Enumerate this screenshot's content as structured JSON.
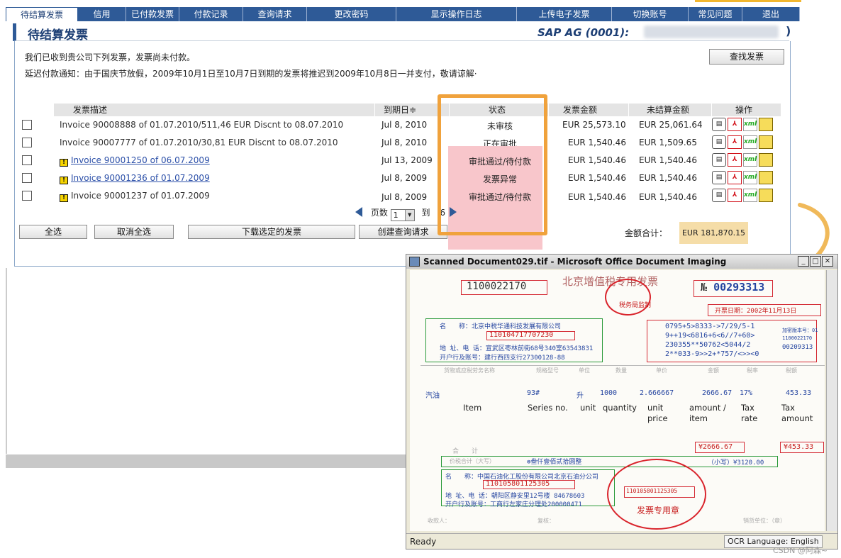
{
  "nav": {
    "tabs": [
      "待结算发票",
      "信用",
      "已付款发票",
      "付款记录",
      "查询请求",
      "更改密码",
      "显示操作日志",
      "上传电子发票",
      "切换账号",
      "常见问题",
      "退出"
    ]
  },
  "header": {
    "title": "待结算发票",
    "company": "SAP AG (0001):"
  },
  "messages": {
    "line1": "我们已收到贵公司下列发票，发票尚未付款。",
    "line2": "延迟付款通知：由于国庆节放假，2009年10月1日至10月7日到期的发票将推迟到2009年10月8日一并支付，敬请谅解·"
  },
  "buttons": {
    "find_invoice": "查找发票",
    "select_all": "全选",
    "deselect_all": "取消全选",
    "download_selected": "下载选定的发票",
    "create_query": "创建查询请求"
  },
  "table": {
    "headers": {
      "desc": "发票描述",
      "due": "到期日≑",
      "status": "状态",
      "amount": "发票金额",
      "open": "未结算金额",
      "ops": "操作"
    },
    "rows": [
      {
        "desc": "Invoice 90008888 of 01.07.2010/511,46 EUR Discnt to 08.07.2010",
        "due": "Jul 8, 2010",
        "status": "未审核",
        "amount": "EUR 25,573.10",
        "open": "EUR 25,061.64"
      },
      {
        "desc": "Invoice 90007777 of 01.07.2010/30,81 EUR Discnt to 08.07.2010",
        "due": "Jul 8, 2010",
        "status": "正在审批",
        "amount": "EUR 1,540.46",
        "open": "EUR 1,509.65"
      },
      {
        "desc": "Invoice 90001250 of 06.07.2009",
        "due": "Jul 13, 2009",
        "status": "审批通过/待付款",
        "amount": "EUR 1,540.46",
        "open": "EUR 1,540.46"
      },
      {
        "desc": "Invoice 90001236 of 01.07.2009",
        "due": "Jul 8, 2009",
        "status": "发票异常",
        "amount": "EUR 1,540.46",
        "open": "EUR 1,540.46"
      },
      {
        "desc": "Invoice 90001237 of 01.07.2009",
        "due": "Jul 8, 2009",
        "status": "审批通过/待付款",
        "amount": "EUR 1,540.46",
        "open": "EUR 1,540.46"
      }
    ],
    "op_icons": [
      "comment-icon",
      "pdf-icon",
      "xml-icon",
      "folder-icon"
    ],
    "xml_label": "xml",
    "pdf_label": "⅄"
  },
  "pager": {
    "page_label": "页数",
    "page_value": "1",
    "to_label": "到",
    "total_pages": "6"
  },
  "total": {
    "label": "金额合计：",
    "value": "EUR 181,870.15"
  },
  "scan_window": {
    "title": "Scanned Document029.tif - Microsoft Office Document Imaging",
    "status_left": "Ready",
    "status_right": "OCR Language: English",
    "invoice": {
      "header": "北京增值税专用发票",
      "code": "1100022170",
      "no_prefix": "№",
      "no": "00293313",
      "date": "开票日期：2002年11月13日",
      "buyer_name": "名　　称：北京中税华通科技发展有限公司",
      "buyer_taxid": "110104717707230",
      "buyer_addr": "地 址、电 话：宣武区枣林前街68号340室63543831",
      "buyer_bank": "开户行及账号：建行西四支行27300128-88",
      "cipher1": "0795+5>8333->7/29/5-1",
      "cipher2": "9++19<6816+6<6//7+60>",
      "cipher3": "230355**50762<5044/2",
      "cipher4": "2**033-9>>2+*757/<>><0",
      "cipher_side1": "加密版本号：01",
      "cipher_side2": "1100022170",
      "cipher_side3": "00209313",
      "item_value": "汽油",
      "series_value": "93#",
      "unit_value": "升",
      "qty_value": "1000",
      "price_value": "2.666667",
      "amount_value": "2666.67",
      "rate_value": "17%",
      "tax_value": "453.33",
      "labels": {
        "item": "Item",
        "series": "Series no.",
        "unit": "unit",
        "qty": "quantity",
        "price": "unit price",
        "amount": "amount / item",
        "rate": "Tax rate",
        "tax": "Tax amount"
      },
      "col_headers": [
        "货物或应税劳务名称",
        "规格型号",
        "单位",
        "数量",
        "单价",
        "金额",
        "税率",
        "税额"
      ],
      "sum_label": "合　　计",
      "sum_amount": "¥2666.67",
      "sum_tax": "¥453.33",
      "total_words_label": "价税合计（大写）",
      "total_words": "⊗叁仟壹佰贰拾圆整",
      "total_small": "（小写）¥3120.00",
      "seller_name": "名　　称：中国石油化工股份有限公司北京石油分公司",
      "seller_taxid": "110105801125305",
      "seller_addr": "地 址、电 话：朝阳区静安里12号楼 84678603",
      "seller_bank": "开户行及账号：工商行左家庄分理处200000471",
      "seal_text": "发票专用章",
      "seal_no": "110105801125305",
      "payee": "收款人：",
      "checker": "复核：",
      "issuer": "销货单位：（章）",
      "stamp_top": "税务局监制"
    }
  },
  "watermark": "CSDN @阿森~"
}
